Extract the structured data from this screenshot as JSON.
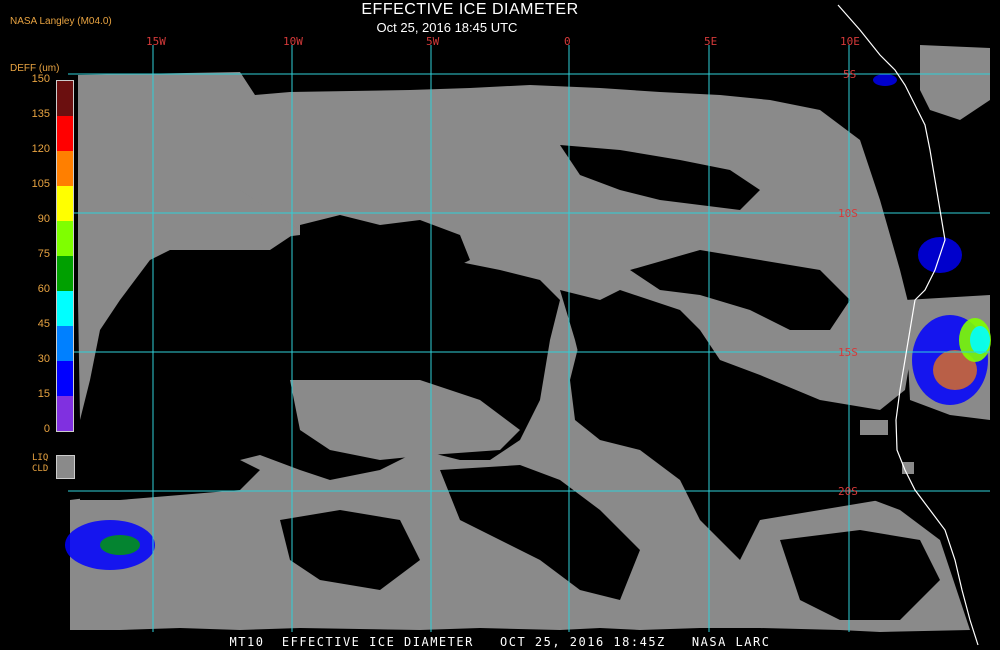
{
  "header": {
    "title": "EFFECTIVE ICE DIAMETER",
    "subtitle": "Oct 25, 2016 18:45 UTC",
    "credit": "NASA Langley (M04.0)"
  },
  "legend": {
    "unit_label": "DEFF (um)",
    "ticks": [
      "150",
      "135",
      "120",
      "105",
      "90",
      "75",
      "60",
      "45",
      "30",
      "15",
      "0"
    ],
    "colors": [
      "#6b0f0f",
      "#ff0000",
      "#ff7f00",
      "#ffff00",
      "#7fff00",
      "#00a000",
      "#00ffff",
      "#0080ff",
      "#0000ff",
      "#8030e0"
    ],
    "liquid_label_1": "LIQ",
    "liquid_label_2": "CLD",
    "liquid_color": "#8a8a8a"
  },
  "map": {
    "lon_labels": [
      "15W",
      "10W",
      "5W",
      "0",
      "5E",
      "10E"
    ],
    "lat_labels": [
      "5S",
      "10S",
      "15S",
      "20S"
    ],
    "grid_color": "#2fd0d8",
    "cloud_color": "#8a8a8a",
    "coast_color": "#ffffff"
  },
  "footer": {
    "text": "MT10  EFFECTIVE ICE DIAMETER   OCT 25, 2016 18:45Z   NASA LARC"
  }
}
